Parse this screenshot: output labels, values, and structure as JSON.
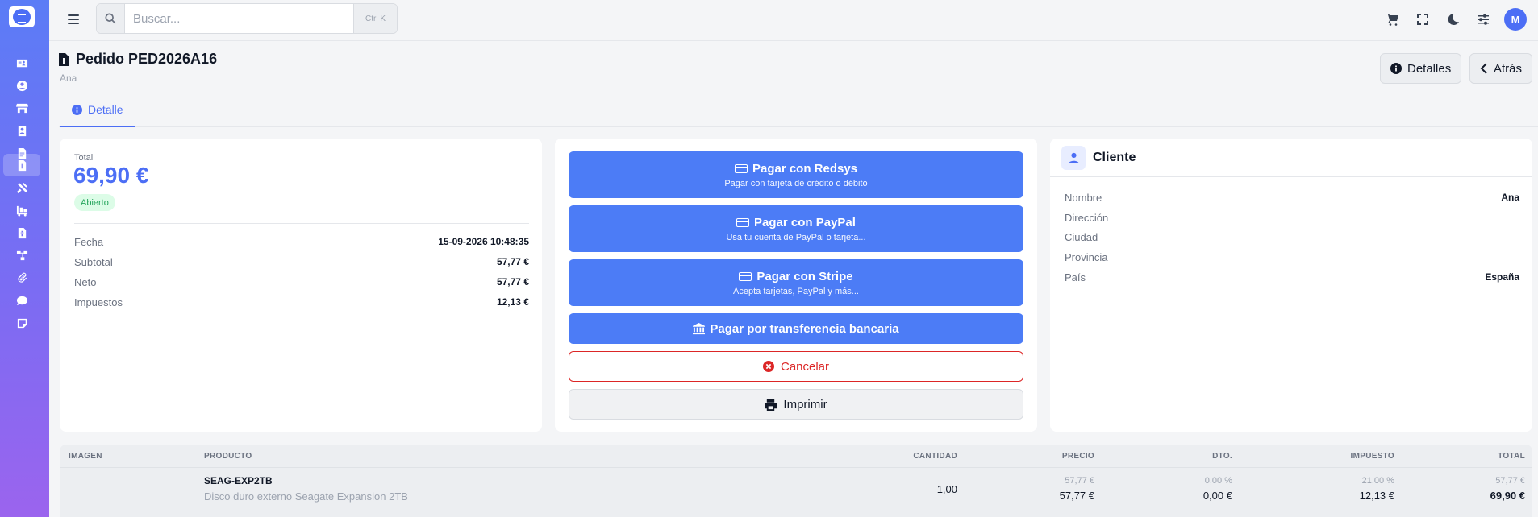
{
  "search": {
    "placeholder": "Buscar...",
    "shortcut": "Ctrl K"
  },
  "user": {
    "initial": "M"
  },
  "page": {
    "title": "Pedido PED2026A16",
    "subtitle": "Ana"
  },
  "header_buttons": {
    "details": "Detalles",
    "back": "Atrás"
  },
  "tabs": [
    {
      "label": "Detalle"
    }
  ],
  "summary": {
    "total_label": "Total",
    "total_value": "69,90 €",
    "status": "Abierto",
    "rows": [
      {
        "label": "Fecha",
        "value": "15-09-2026 10:48:35"
      },
      {
        "label": "Subtotal",
        "value": "57,77 €"
      },
      {
        "label": "Neto",
        "value": "57,77 €"
      },
      {
        "label": "Impuestos",
        "value": "12,13 €"
      }
    ]
  },
  "payments": {
    "redsys": {
      "title": "Pagar con Redsys",
      "subtitle": "Pagar con tarjeta de crédito o débito"
    },
    "paypal": {
      "title": "Pagar con PayPal",
      "subtitle": "Usa tu cuenta de PayPal o tarjeta..."
    },
    "stripe": {
      "title": "Pagar con Stripe",
      "subtitle": "Acepta tarjetas, PayPal y más..."
    },
    "transfer": {
      "title": "Pagar por transferencia bancaria"
    },
    "cancel": "Cancelar",
    "print": "Imprimir"
  },
  "client": {
    "title": "Cliente",
    "rows": [
      {
        "label": "Nombre",
        "value": "Ana"
      },
      {
        "label": "Dirección",
        "value": ""
      },
      {
        "label": "Ciudad",
        "value": ""
      },
      {
        "label": "Provincia",
        "value": ""
      },
      {
        "label": "País",
        "value": "España"
      }
    ]
  },
  "table": {
    "headers": {
      "image": "IMAGEN",
      "product": "PRODUCTO",
      "qty": "CANTIDAD",
      "price": "PRECIO",
      "discount": "DTO.",
      "tax": "IMPUESTO",
      "total": "TOTAL"
    },
    "rows": [
      {
        "sku": "SEAG-EXP2TB",
        "description": "Disco duro externo Seagate Expansion 2TB",
        "qty": "1,00",
        "price_base": "57,77 €",
        "price": "57,77 €",
        "discount_pct": "0,00 %",
        "discount": "0,00 €",
        "tax_pct": "21,00 %",
        "tax": "12,13 €",
        "total_base": "57,77 €",
        "total": "69,90 €"
      }
    ]
  },
  "colors": {
    "accent": "#4c7cf6",
    "danger": "#dc2626",
    "success": "#22a35a"
  }
}
